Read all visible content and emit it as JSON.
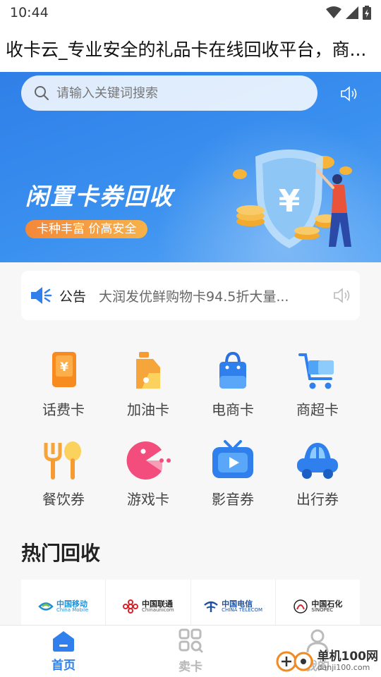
{
  "status_bar": {
    "time": "10:44"
  },
  "page_title": "收卡云_专业安全的礼品卡在线回收平台，商...",
  "search": {
    "placeholder": "请输入关键词搜索"
  },
  "banner": {
    "title": "闲置卡券回收",
    "tagline": "卡种丰富 价高安全"
  },
  "notice": {
    "label": "公告",
    "text": "大润发优鲜购物卡94.5折大量..."
  },
  "categories": [
    {
      "label": "话费卡",
      "icon": "phone-card-icon"
    },
    {
      "label": "加油卡",
      "icon": "fuel-can-icon"
    },
    {
      "label": "电商卡",
      "icon": "shopping-bag-icon"
    },
    {
      "label": "商超卡",
      "icon": "shopping-cart-icon"
    },
    {
      "label": "餐饮券",
      "icon": "fork-spoon-icon"
    },
    {
      "label": "游戏卡",
      "icon": "pacman-icon"
    },
    {
      "label": "影音券",
      "icon": "tv-play-icon"
    },
    {
      "label": "出行券",
      "icon": "car-icon"
    }
  ],
  "hot": {
    "title": "热门回收",
    "items": [
      {
        "cn": "中国移动",
        "en": "China Mobile",
        "color": "#1f8fd6"
      },
      {
        "cn": "中国联通",
        "en": "Chinaunicom",
        "color": "#d6242a"
      },
      {
        "cn": "中国电信",
        "en": "CHINA TELECOM",
        "color": "#1d4fa2"
      },
      {
        "cn": "中国石化",
        "en": "SINOPEC",
        "color": "#222222"
      }
    ]
  },
  "tabs": [
    {
      "label": "首页",
      "icon": "home-icon",
      "active": true
    },
    {
      "label": "卖卡",
      "icon": "grid-search-icon",
      "active": false
    },
    {
      "label": "我的",
      "icon": "user-icon",
      "active": false
    }
  ],
  "watermark": {
    "name": "单机100网",
    "url": "danji100.com"
  },
  "colors": {
    "accent": "#2f80ed",
    "banner": "#3a90ef",
    "orange": "#f4883a"
  }
}
